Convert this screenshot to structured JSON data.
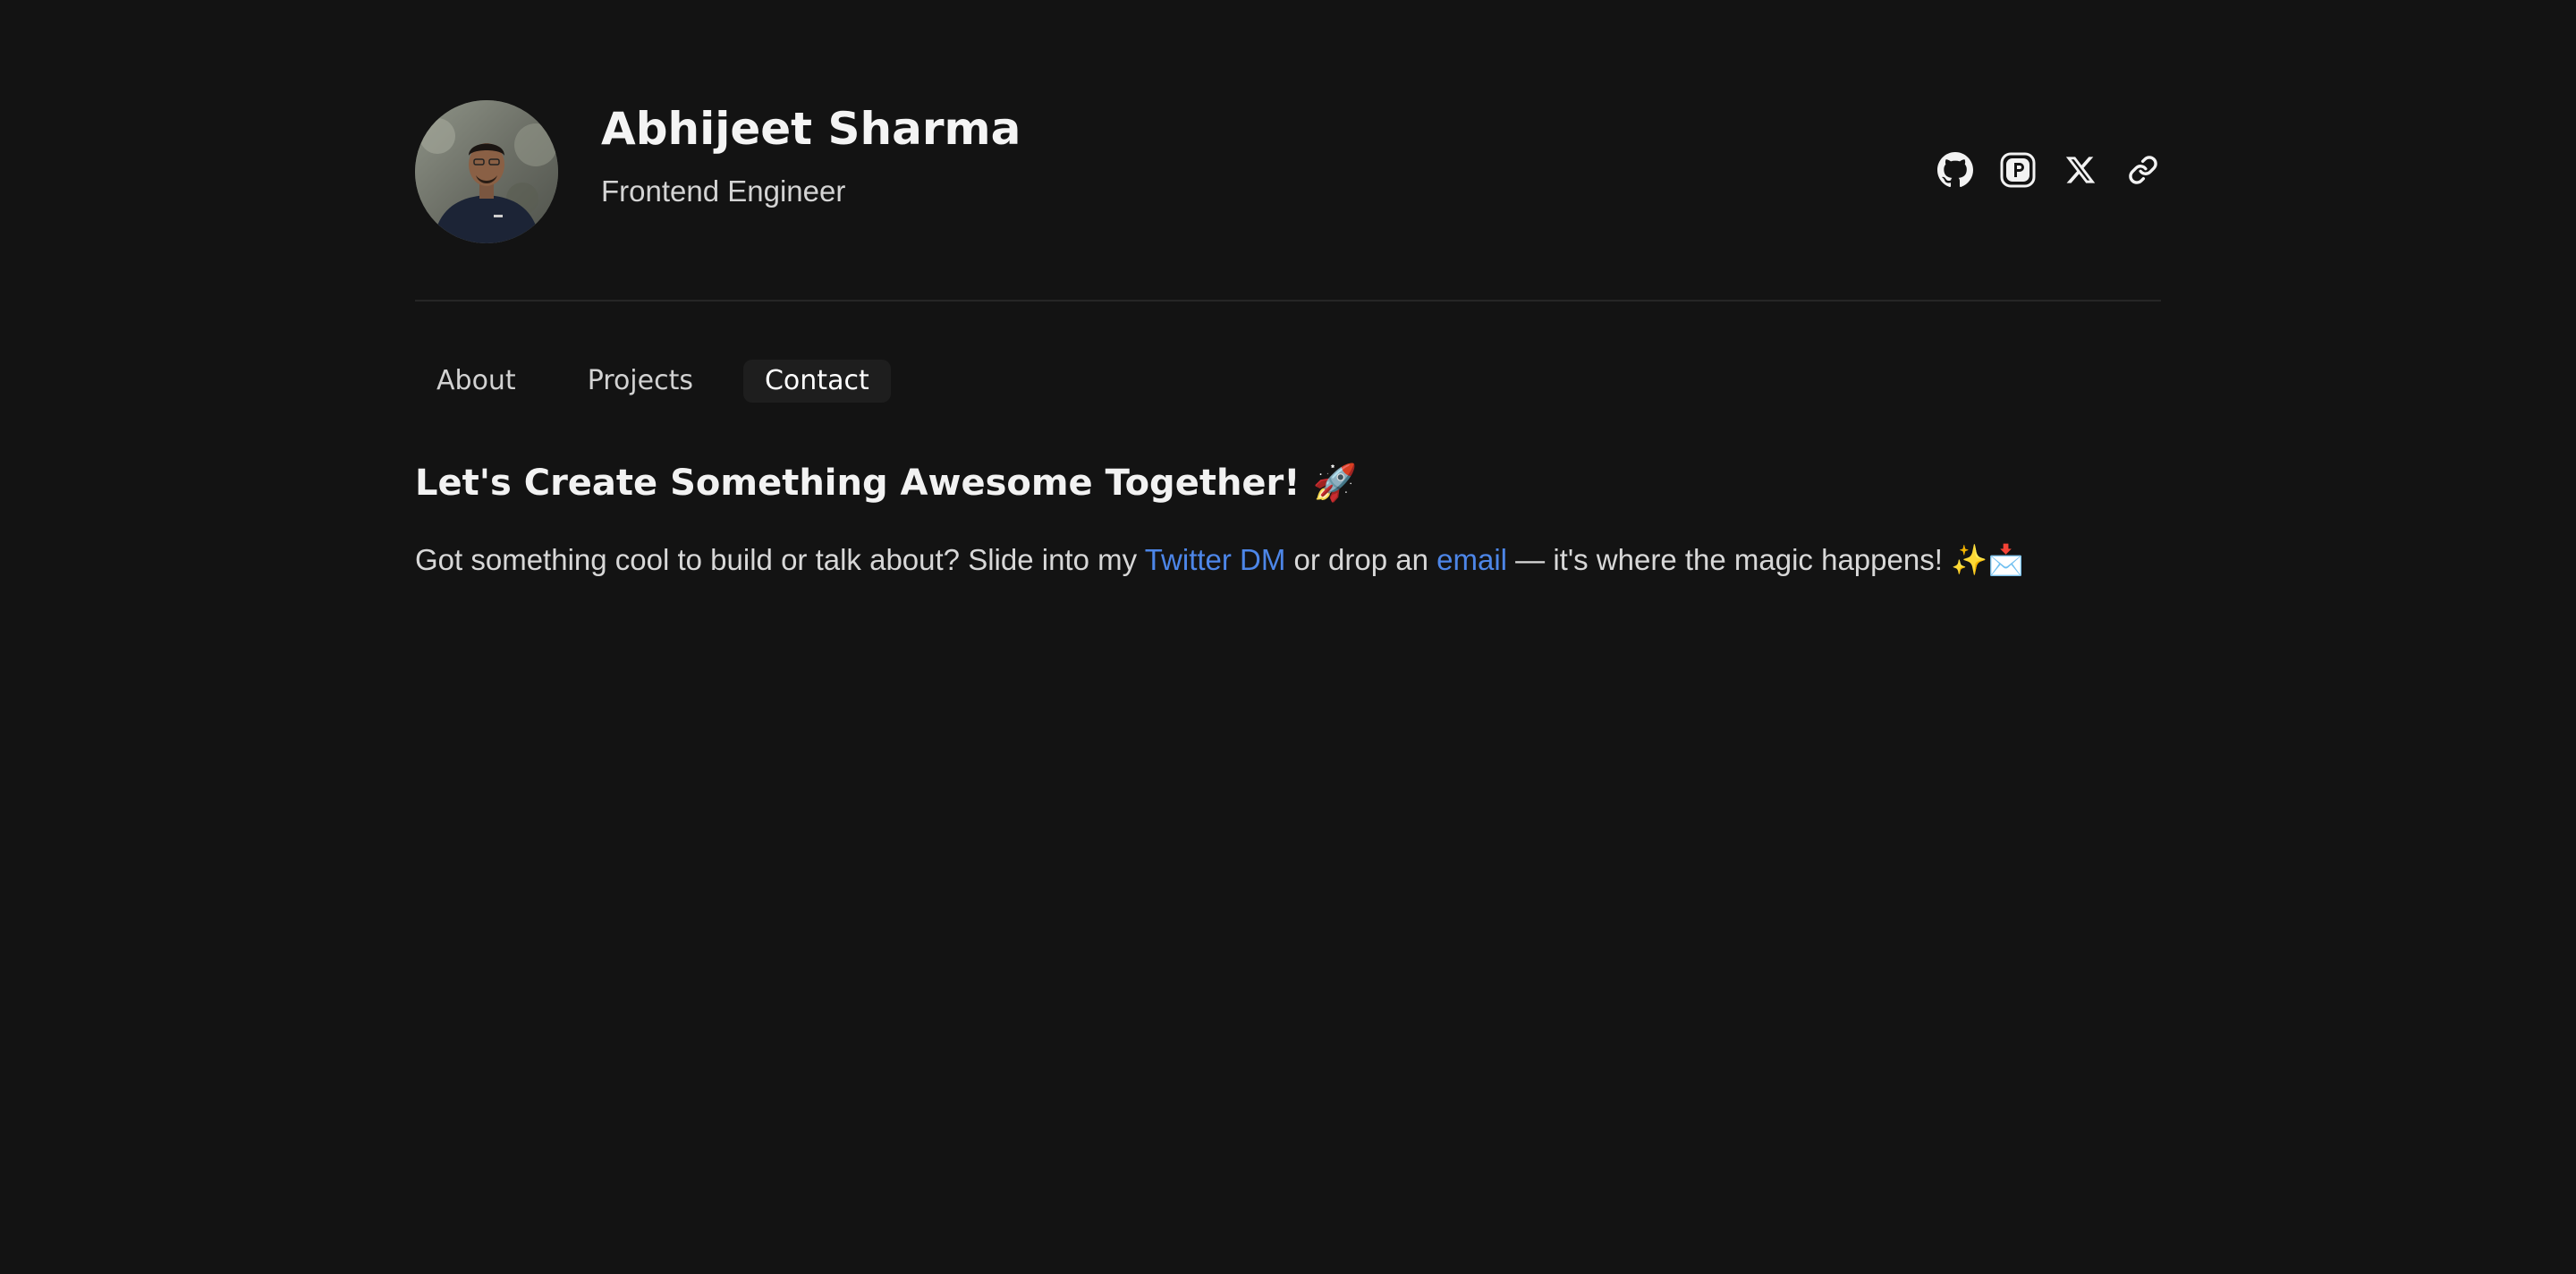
{
  "profile": {
    "name": "Abhijeet Sharma",
    "role": "Frontend Engineer"
  },
  "socials": [
    {
      "icon": "github-icon"
    },
    {
      "icon": "producthunt-icon"
    },
    {
      "icon": "x-twitter-icon"
    },
    {
      "icon": "link-icon"
    }
  ],
  "nav": {
    "tabs": [
      {
        "label": "About",
        "active": false
      },
      {
        "label": "Projects",
        "active": false
      },
      {
        "label": "Contact",
        "active": true
      }
    ]
  },
  "contact": {
    "heading": "Let's Create Something Awesome Together! 🚀",
    "text_before": "Got something cool to build or talk about? Slide into my ",
    "twitter_link": "Twitter DM",
    "text_middle": " or drop an ",
    "email_link": "email",
    "text_after": " — it's where the magic happens! ✨📩"
  },
  "colors": {
    "background": "#131313",
    "link": "#4d86e8",
    "active_tab_bg": "#1e1e1e"
  }
}
